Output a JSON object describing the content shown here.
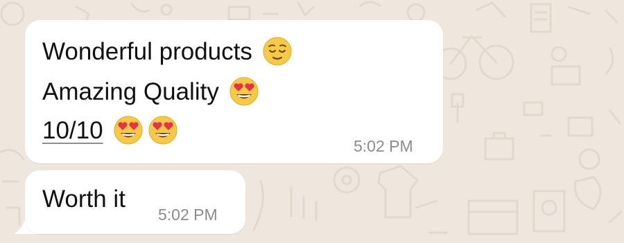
{
  "messages": [
    {
      "lines": [
        {
          "text": "Wonderful products",
          "emojis": [
            "relieved-face"
          ]
        },
        {
          "text": "Amazing Quality",
          "emojis": [
            "smiling-face-with-heart-eyes"
          ]
        },
        {
          "text": "10/10",
          "emojis": [
            "smiling-face-with-heart-eyes",
            "smiling-face-with-heart-eyes"
          ]
        }
      ],
      "time": "5:02 PM"
    },
    {
      "lines": [
        {
          "text": "Worth it",
          "emojis": []
        }
      ],
      "time": "5:02 PM"
    }
  ],
  "colors": {
    "wallpaper": "#efe7de",
    "bubble": "#ffffff",
    "text": "#111111",
    "timestamp": "#8c8c8c"
  }
}
